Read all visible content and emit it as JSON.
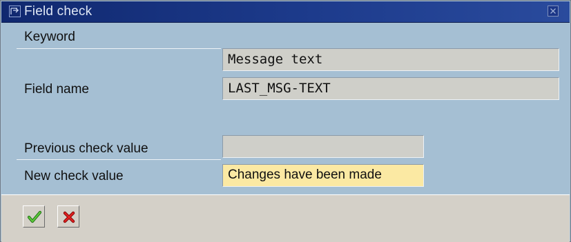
{
  "window": {
    "title": "Field check"
  },
  "form": {
    "keyword_label": "Keyword",
    "keyword_value": "Message text",
    "field_name_label": "Field name",
    "field_name_value": "LAST_MSG-TEXT",
    "previous_check_label": "Previous check value",
    "previous_check_value": "",
    "new_check_label": "New check value",
    "new_check_value": "Changes have been made"
  },
  "toolbar": {
    "confirm_icon": "green-check-icon",
    "cancel_icon": "red-x-icon"
  },
  "colors": {
    "titlebar": "#10286f",
    "client_bg": "#a5bfd3",
    "readonly_field": "#cfcfc9",
    "highlight_field": "#fbe9a3"
  }
}
